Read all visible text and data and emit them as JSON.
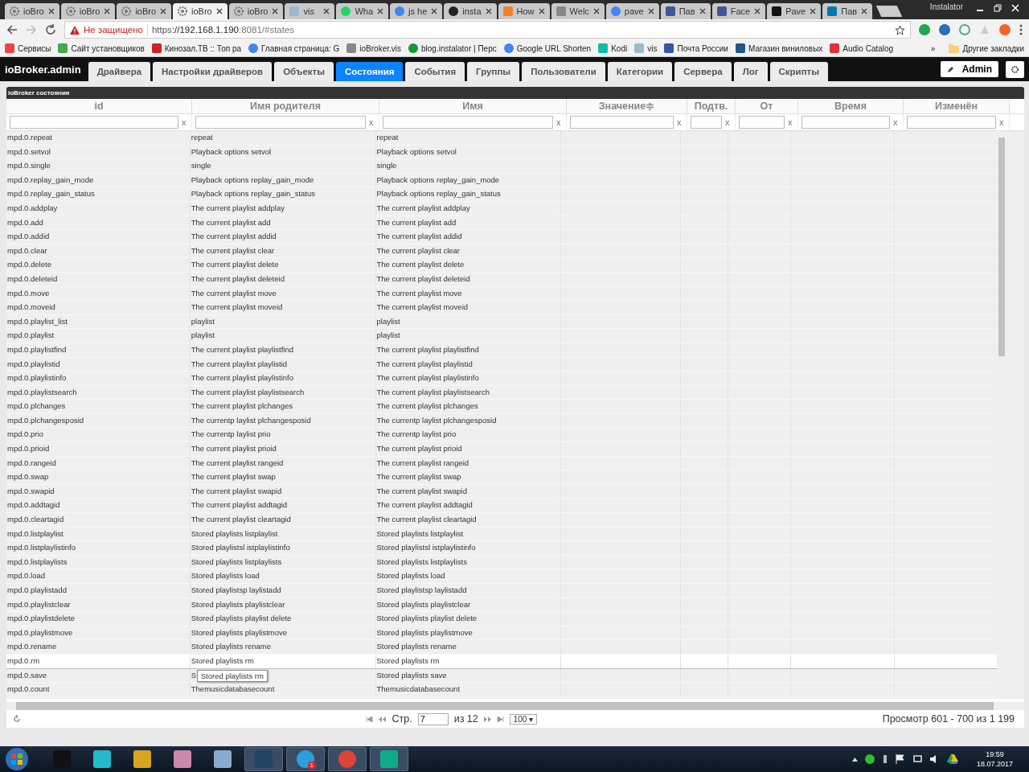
{
  "browser": {
    "tabs": [
      {
        "title": "ioBro",
        "selected": false
      },
      {
        "title": "ioBro",
        "selected": false
      },
      {
        "title": "ioBro",
        "selected": false
      },
      {
        "title": "ioBro",
        "selected": true
      },
      {
        "title": "ioBro",
        "selected": false
      },
      {
        "title": "vis",
        "selected": false
      },
      {
        "title": "Wha",
        "selected": false
      },
      {
        "title": "js he",
        "selected": false
      },
      {
        "title": "insta",
        "selected": false
      },
      {
        "title": "How",
        "selected": false
      },
      {
        "title": "Welc",
        "selected": false
      },
      {
        "title": "pave",
        "selected": false
      },
      {
        "title": "Пав",
        "selected": false
      },
      {
        "title": "Face",
        "selected": false
      },
      {
        "title": "Pave",
        "selected": false
      },
      {
        "title": "Пав",
        "selected": false
      }
    ],
    "profile": "Instalator",
    "security": "Не защищено",
    "url_scheme": "https",
    "url_host": "://192.168.1.190",
    "url_rest": ":8081/#states",
    "bookmarks": [
      "Сервисы",
      "Сайт установщиков",
      "Кинозал.ТВ :: Топ ра",
      "Главная страница: G",
      "ioBroker.vis",
      "blog.instalator | Перс",
      "Google URL Shorten",
      "Kodi",
      "vis",
      "Почта России",
      "Магазин виниловых",
      "Audio Catalog"
    ],
    "bookmarks_more": "»",
    "other_bookmarks": "Другие закладки"
  },
  "app": {
    "title": "ioBroker.admin",
    "tabs": [
      {
        "label": "Драйвера",
        "selected": false
      },
      {
        "label": "Настройки драйверов",
        "selected": false
      },
      {
        "label": "Объекты",
        "selected": false
      },
      {
        "label": "Состояния",
        "selected": true
      },
      {
        "label": "События",
        "selected": false
      },
      {
        "label": "Группы",
        "selected": false
      },
      {
        "label": "Пользователи",
        "selected": false
      },
      {
        "label": "Категории",
        "selected": false
      },
      {
        "label": "Сервера",
        "selected": false
      },
      {
        "label": "Лог",
        "selected": false
      },
      {
        "label": "Скрипты",
        "selected": false
      }
    ],
    "user": "Admin"
  },
  "table": {
    "title": "ioBroker состояния",
    "columns": [
      {
        "label": "id",
        "clear": "x"
      },
      {
        "label": "Имя родителя",
        "clear": "x"
      },
      {
        "label": "Имя",
        "clear": "x"
      },
      {
        "label": "Значение",
        "clear": "x"
      },
      {
        "label": "Подтв.",
        "clear": "x"
      },
      {
        "label": "От",
        "clear": "x"
      },
      {
        "label": "Время",
        "clear": "x"
      },
      {
        "label": "Изменён",
        "clear": "x"
      }
    ],
    "sort_mark": "≑",
    "rows": [
      {
        "id": "mpd.0.repeat",
        "parent": "repeat",
        "name": "repeat",
        "hovered": false
      },
      {
        "id": "mpd.0.setvol",
        "parent": "Playback options setvol",
        "name": "Playback options setvol",
        "hovered": false
      },
      {
        "id": "mpd.0.single",
        "parent": "single",
        "name": "single",
        "hovered": false
      },
      {
        "id": "mpd.0.replay_gain_mode",
        "parent": "Playback options replay_gain_mode",
        "name": "Playback options replay_gain_mode",
        "hovered": false
      },
      {
        "id": "mpd.0.replay_gain_status",
        "parent": "Playback options replay_gain_status",
        "name": "Playback options replay_gain_status",
        "hovered": false
      },
      {
        "id": "mpd.0.addplay",
        "parent": "The current playlist addplay",
        "name": "The current playlist addplay",
        "hovered": false
      },
      {
        "id": "mpd.0.add",
        "parent": "The current playlist add",
        "name": "The current playlist add",
        "hovered": false
      },
      {
        "id": "mpd.0.addid",
        "parent": "The current playlist addid",
        "name": "The current playlist addid",
        "hovered": false
      },
      {
        "id": "mpd.0.clear",
        "parent": "The current playlist clear",
        "name": "The current playlist clear",
        "hovered": false
      },
      {
        "id": "mpd.0.delete",
        "parent": "The current playlist delete",
        "name": "The current playlist delete",
        "hovered": false
      },
      {
        "id": "mpd.0.deleteid",
        "parent": "The current playlist deleteid",
        "name": "The current playlist deleteid",
        "hovered": false
      },
      {
        "id": "mpd.0.move",
        "parent": "The current playlist move",
        "name": "The current playlist move",
        "hovered": false
      },
      {
        "id": "mpd.0.moveid",
        "parent": "The current playlist moveid",
        "name": "The current playlist moveid",
        "hovered": false
      },
      {
        "id": "mpd.0.playlist_list",
        "parent": "playlist",
        "name": "playlist",
        "hovered": false
      },
      {
        "id": "mpd.0.playlist",
        "parent": "playlist",
        "name": "playlist",
        "hovered": false
      },
      {
        "id": "mpd.0.playlistfind",
        "parent": "The current playlist playlistfind",
        "name": "The current playlist playlistfind",
        "hovered": false
      },
      {
        "id": "mpd.0.playlistid",
        "parent": "The current playlist playlistid",
        "name": "The current playlist playlistid",
        "hovered": false
      },
      {
        "id": "mpd.0.playlistinfo",
        "parent": "The current playlist playlistinfo",
        "name": "The current playlist playlistinfo",
        "hovered": false
      },
      {
        "id": "mpd.0.playlistsearch",
        "parent": "The current playlist playlistsearch",
        "name": "The current playlist playlistsearch",
        "hovered": false
      },
      {
        "id": "mpd.0.plchanges",
        "parent": "The current playlist plchanges",
        "name": "The current playlist plchanges",
        "hovered": false
      },
      {
        "id": "mpd.0.plchangesposid",
        "parent": "The currentp laylist plchangesposid",
        "name": "The currentp laylist plchangesposid",
        "hovered": false
      },
      {
        "id": "mpd.0.prio",
        "parent": "The currentp laylist prio",
        "name": "The currentp laylist prio",
        "hovered": false
      },
      {
        "id": "mpd.0.prioid",
        "parent": "The current playlist prioid",
        "name": "The current playlist prioid",
        "hovered": false
      },
      {
        "id": "mpd.0.rangeid",
        "parent": "The current playlist rangeid",
        "name": "The current playlist rangeid",
        "hovered": false
      },
      {
        "id": "mpd.0.swap",
        "parent": "The current playlist swap",
        "name": "The current playlist swap",
        "hovered": false
      },
      {
        "id": "mpd.0.swapid",
        "parent": "The current playlist swapid",
        "name": "The current playlist swapid",
        "hovered": false
      },
      {
        "id": "mpd.0.addtagid",
        "parent": "The current playlist addtagid",
        "name": "The current playlist addtagid",
        "hovered": false
      },
      {
        "id": "mpd.0.cleartagid",
        "parent": "The current playlist cleartagid",
        "name": "The current playlist cleartagid",
        "hovered": false
      },
      {
        "id": "mpd.0.listplaylist",
        "parent": "Stored playlists listplaylist",
        "name": "Stored playlists listplaylist",
        "hovered": false
      },
      {
        "id": "mpd.0.listplaylistinfo",
        "parent": "Stored playlistsl istplaylistinfo",
        "name": "Stored playlistsl istplaylistinfo",
        "hovered": false
      },
      {
        "id": "mpd.0.listplaylists",
        "parent": "Stored playlists listplaylists",
        "name": "Stored playlists listplaylists",
        "hovered": false
      },
      {
        "id": "mpd.0.load",
        "parent": "Stored playlists load",
        "name": "Stored playlists load",
        "hovered": false
      },
      {
        "id": "mpd.0.playlistadd",
        "parent": "Stored playlistsp laylistadd",
        "name": "Stored playlistsp laylistadd",
        "hovered": false
      },
      {
        "id": "mpd.0.playlistclear",
        "parent": "Stored playlists playlistclear",
        "name": "Stored playlists playlistclear",
        "hovered": false
      },
      {
        "id": "mpd.0.playlistdelete",
        "parent": "Stored playlists playlist delete",
        "name": "Stored playlists playlist delete",
        "hovered": false
      },
      {
        "id": "mpd.0.playlistmove",
        "parent": "Stored playlists playlistmove",
        "name": "Stored playlists playlistmove",
        "hovered": false
      },
      {
        "id": "mpd.0.rename",
        "parent": "Stored playlists rename",
        "name": "Stored playlists rename",
        "hovered": false
      },
      {
        "id": "mpd.0.rm",
        "parent": "Stored playlists rm",
        "name": "Stored playlists rm",
        "hovered": true
      },
      {
        "id": "mpd.0.save",
        "parent": "S",
        "name": "Stored playlists save",
        "hovered": false,
        "tooltip": "Stored playlists rm"
      },
      {
        "id": "mpd.0.count",
        "parent": "Themusicdatabasecount",
        "name": "Themusicdatabasecount",
        "hovered": false
      }
    ]
  },
  "pager": {
    "page_label": "Стр.",
    "page": "7",
    "of": "из 12",
    "page_size": "100 ▾",
    "summary": "Просмотр 601 - 700 из 1 199"
  },
  "taskbar": {
    "apps": [
      {
        "open": false
      },
      {
        "open": false
      },
      {
        "open": false
      },
      {
        "open": false
      },
      {
        "open": false
      },
      {
        "open": true
      },
      {
        "open": true,
        "badge": "1"
      },
      {
        "open": true
      },
      {
        "open": true
      }
    ],
    "time": "19:59",
    "date": "18.07.2017"
  }
}
